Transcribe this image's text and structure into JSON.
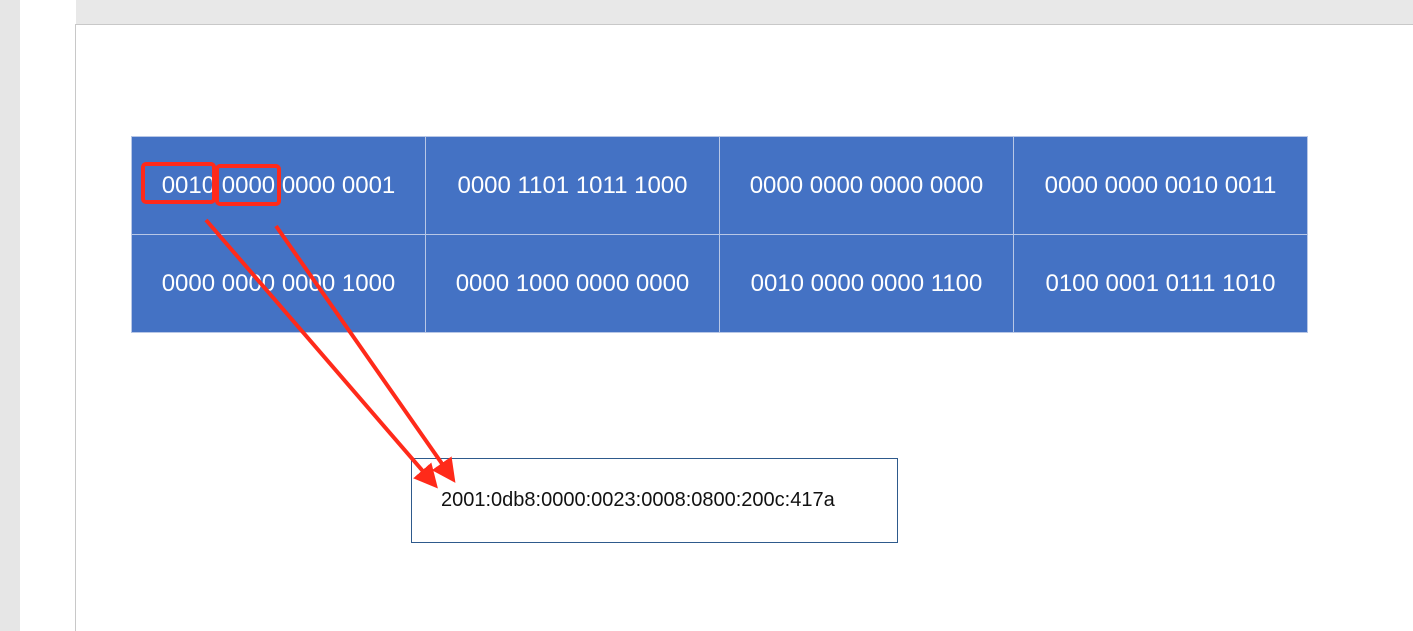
{
  "table": {
    "rows": [
      [
        "0010 0000 0000 0001",
        "0000 1101 1011 1000",
        "0000 0000 0000 0000",
        "0000 0000 0010 0011"
      ],
      [
        "0000 0000 0000 1000",
        "0000 1000 0000 0000",
        "0010 0000 0000 1100",
        "0100 0001 0111 1010"
      ]
    ]
  },
  "result": {
    "address": "2001:0db8:0000:0023:0008:0800:200c:417a"
  },
  "colors": {
    "cell_fill": "#4472c4",
    "cell_text": "#ffffff",
    "highlight": "#ff2a1a",
    "arrow": "#ff2a1a",
    "box_border": "#2e5a8c"
  }
}
